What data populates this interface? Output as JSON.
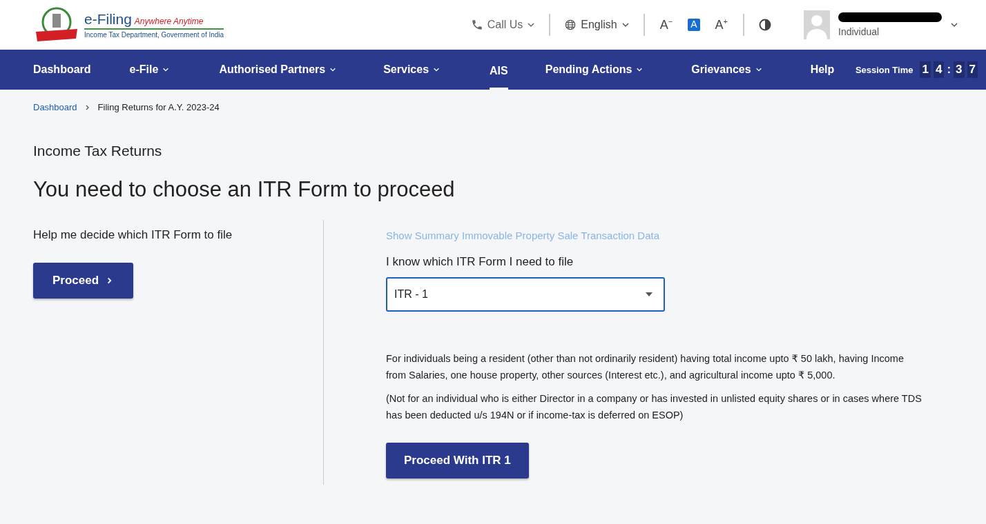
{
  "header": {
    "logo_title": "e-Filing",
    "logo_tagline": "Anywhere Anytime",
    "logo_subtitle": "Income Tax Department, Government of India",
    "call_us": "Call Us",
    "language": "English",
    "font_controls": [
      {
        "label": "A",
        "sign": "−",
        "selected": false
      },
      {
        "label": "A",
        "selected": true
      },
      {
        "label": "A",
        "sign": "+",
        "selected": false
      }
    ],
    "user_role": "Individual"
  },
  "nav": {
    "items": [
      {
        "label": "Dashboard",
        "dropdown": false,
        "selected": false
      },
      {
        "label": "e-File",
        "dropdown": true,
        "selected": false
      },
      {
        "label": "Authorised Partners",
        "dropdown": true,
        "selected": false
      },
      {
        "label": "Services",
        "dropdown": true,
        "selected": false
      },
      {
        "label": "AIS",
        "dropdown": false,
        "selected": true
      },
      {
        "label": "Pending Actions",
        "dropdown": true,
        "selected": false
      },
      {
        "label": "Grievances",
        "dropdown": true,
        "selected": false
      },
      {
        "label": "Help",
        "dropdown": false,
        "selected": false
      }
    ],
    "session_label": "Session Time",
    "session_digits": [
      "1",
      "4",
      ":",
      "3",
      "7"
    ]
  },
  "breadcrumb": [
    "Dashboard",
    "Filing Returns for A.Y. 2023-24"
  ],
  "section_title": "Income Tax Returns",
  "heading": "You need to choose an ITR Form to proceed",
  "left": {
    "prompt": "Help me decide which ITR Form to file",
    "button": "Proceed"
  },
  "right": {
    "link": "Show Summary Immovable Property Sale Transaction Data",
    "label": "I know which ITR Form I need to file",
    "select_value": "ITR - 1",
    "description": [
      "For individuals being a resident (other than not ordinarily resident) having total income upto ₹ 50 lakh, having Income from Salaries, one house property, other sources (Interest etc.), and agricultural income upto ₹ 5,000.",
      "(Not for an individual who is either Director in a company or has invested in unlisted equity shares or in cases where TDS has been deducted u/s 194N or if income-tax is deferred on ESOP)"
    ],
    "button": "Proceed With ITR 1"
  }
}
